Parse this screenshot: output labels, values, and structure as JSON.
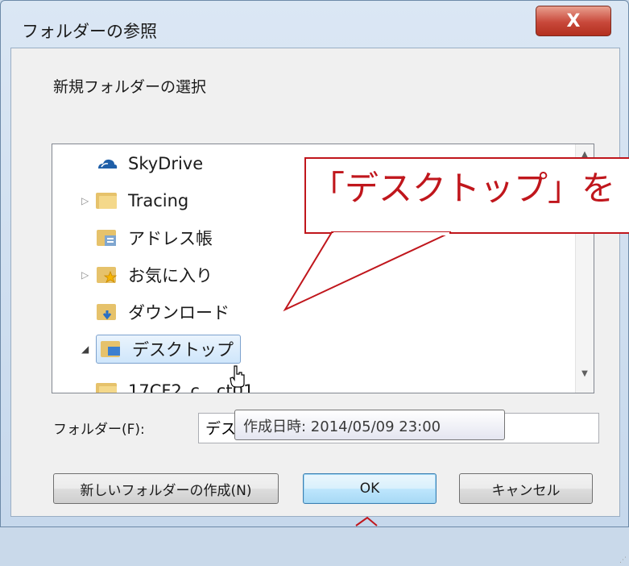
{
  "window": {
    "title": "フォルダーの参照",
    "close_label": "X"
  },
  "dialog": {
    "instruction": "新規フォルダーの選択"
  },
  "tree": {
    "items": [
      {
        "label": "SkyDrive",
        "icon": "cloud-icon",
        "expander": ""
      },
      {
        "label": "Tracing",
        "icon": "folder-icon",
        "expander": "▷"
      },
      {
        "label": "アドレス帳",
        "icon": "address-book-icon",
        "expander": ""
      },
      {
        "label": "お気に入り",
        "icon": "favorites-folder-icon",
        "expander": "▷"
      },
      {
        "label": "ダウンロード",
        "icon": "downloads-folder-icon",
        "expander": ""
      },
      {
        "label": "デスクトップ",
        "icon": "desktop-folder-icon",
        "expander": "◢",
        "selected": true
      },
      {
        "label": "17CF2_c…ct01",
        "icon": "folder-icon",
        "expander": "▷"
      }
    ]
  },
  "folder_field": {
    "label": "フォルダー(F):",
    "value": "デス"
  },
  "tooltip": {
    "text": "作成日時: 2014/05/09 23:00"
  },
  "buttons": {
    "new_folder": "新しいフォルダーの作成(N)",
    "ok": "OK",
    "cancel": "キャンセル"
  },
  "callout": {
    "text": "「デスクトップ」を"
  },
  "colors": {
    "callout_red": "#c0161c",
    "selection_blue": "#cfe6fb"
  }
}
